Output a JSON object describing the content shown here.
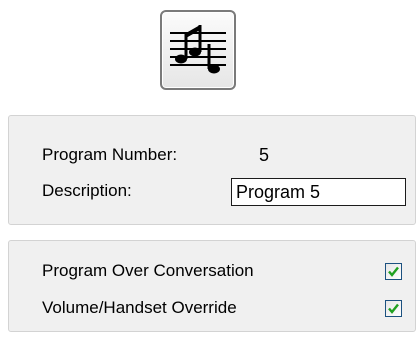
{
  "toolbar": {
    "icon": "music-notes-icon"
  },
  "program": {
    "number_label": "Program Number:",
    "number_value": "5",
    "description_label": "Description:",
    "description_value": "Program 5"
  },
  "options": {
    "items": [
      {
        "label": "Program Over Conversation",
        "checked": true
      },
      {
        "label": "Volume/Handset Override",
        "checked": true
      }
    ]
  },
  "colors": {
    "panel_background": "#f0f0f0",
    "checkmark": "#21a121",
    "checkbox_border": "#1c5180"
  }
}
